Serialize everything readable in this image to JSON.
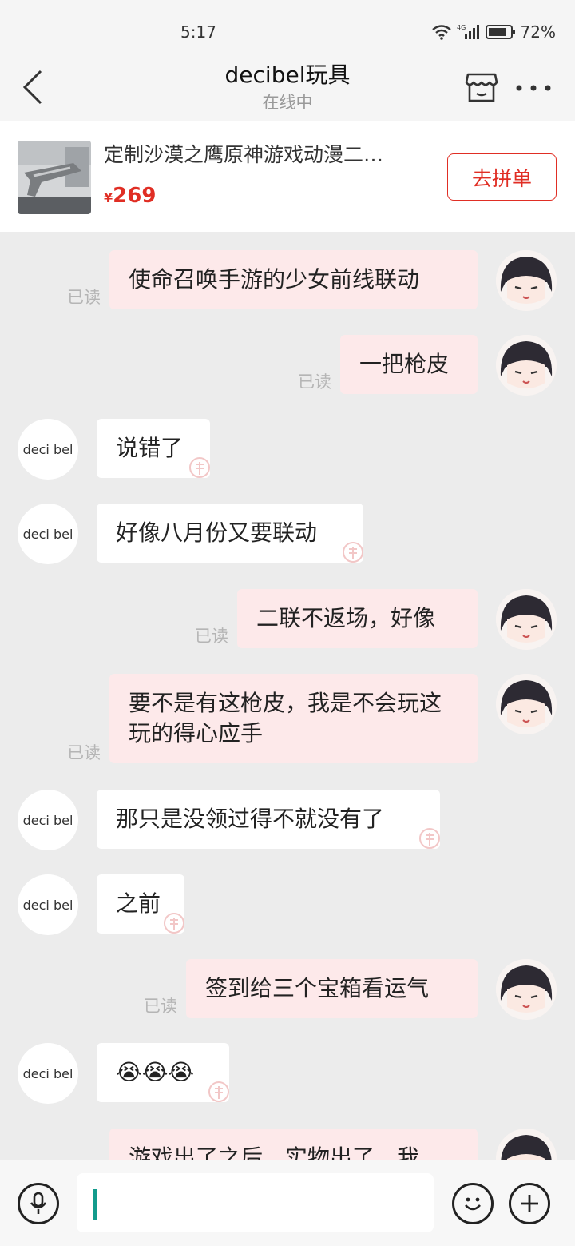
{
  "status_bar": {
    "time": "5:17",
    "network": "4G",
    "battery": "72%"
  },
  "header": {
    "title": "decibel玩具",
    "subtitle": "在线中"
  },
  "product": {
    "title": "定制沙漠之鹰原神游戏动漫二…",
    "currency": "¥",
    "price": "269",
    "button_label": "去拼单"
  },
  "shop_avatar_text": "deci bel",
  "messages": [
    {
      "from": "me",
      "text": "使命召唤手游的少女前线联动",
      "read": "已读"
    },
    {
      "from": "me",
      "text": "一把枪皮",
      "read": "已读"
    },
    {
      "from": "shop",
      "text": "说错了"
    },
    {
      "from": "shop",
      "text": "好像八月份又要联动"
    },
    {
      "from": "me",
      "text": "二联不返场，好像",
      "read": "已读"
    },
    {
      "from": "me",
      "text": "要不是有这枪皮，我是不会玩这玩的得心应手",
      "read": "已读"
    },
    {
      "from": "shop",
      "text": "那只是没领过得不就没有了"
    },
    {
      "from": "shop",
      "text": "之前"
    },
    {
      "from": "me",
      "text": "签到给三个宝箱看运气",
      "read": "已读"
    },
    {
      "from": "shop",
      "text": "😭😭😭"
    },
    {
      "from": "me",
      "text": "游戏出了之后，实物出了，我"
    }
  ],
  "input": {
    "placeholder": ""
  },
  "icons": {
    "back": "chevron-left-icon",
    "store": "store-icon",
    "more": "more-dots-icon",
    "voice": "microphone-icon",
    "emoji": "smiley-icon",
    "plus": "plus-icon",
    "wifi": "wifi-icon",
    "signal": "signal-icon",
    "battery": "battery-icon"
  },
  "colors": {
    "accent": "#e02e24",
    "bubble_me": "#fde9ea",
    "bubble_shop": "#ffffff",
    "chat_bg": "#ececec"
  }
}
